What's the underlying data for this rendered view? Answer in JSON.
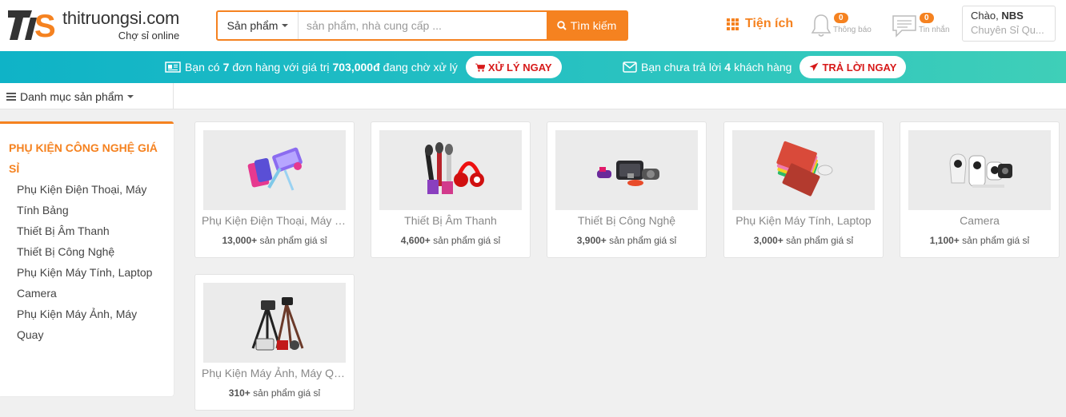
{
  "header": {
    "logo_name": "thitruongsi.com",
    "logo_slogan": "Chợ sỉ online",
    "search": {
      "select_label": "Sản phẩm",
      "placeholder": "sản phẩm, nhà cung cấp ...",
      "value": "",
      "button_label": "Tìm kiếm"
    },
    "tienich_label": "Tiện ích",
    "notifications": {
      "count": "0",
      "label": "Thông báo"
    },
    "messages": {
      "count": "0",
      "label": "Tin nhắn"
    },
    "user": {
      "greeting": "Chào,",
      "name": "NBS",
      "role": "Chuyên Sỉ Qu..."
    }
  },
  "alertbar": {
    "orders": {
      "prefix": "Bạn có",
      "count": "7",
      "middle": "đơn hàng với giá trị",
      "amount": "703,000đ",
      "suffix": "đang chờ xử lý",
      "button_label": "XỬ LÝ NGAY"
    },
    "customers": {
      "prefix": "Bạn chưa trả lời",
      "count": "4",
      "suffix": "khách hàng",
      "button_label": "TRẢ LỜI NGAY"
    }
  },
  "catbar": {
    "toggle_label": "Danh mục sản phẩm"
  },
  "sidebar": {
    "title": "PHỤ KIỆN CÔNG NGHỆ GIÁ SỈ",
    "items": [
      {
        "label": "Phụ Kiện Điện Thoại, Máy Tính Bảng"
      },
      {
        "label": "Thiết Bị Âm Thanh"
      },
      {
        "label": "Thiết Bị Công Nghệ"
      },
      {
        "label": "Phụ Kiện Máy Tính, Laptop"
      },
      {
        "label": "Camera"
      },
      {
        "label": "Phụ Kiện Máy Ảnh, Máy Quay"
      }
    ]
  },
  "cards": [
    {
      "name": "Phụ Kiện Điện Thoại, Máy T...",
      "count": "13,000+",
      "count_suffix": "sản phẩm giá sỉ",
      "image_icon": "phone-accessories-image"
    },
    {
      "name": "Thiết Bị Âm Thanh",
      "count": "4,600+",
      "count_suffix": "sản phẩm giá sỉ",
      "image_icon": "audio-devices-image"
    },
    {
      "name": "Thiết Bị Công Nghệ",
      "count": "3,900+",
      "count_suffix": "sản phẩm giá sỉ",
      "image_icon": "tech-gadgets-image"
    },
    {
      "name": "Phụ Kiện Máy Tính, Laptop",
      "count": "3,000+",
      "count_suffix": "sản phẩm giá sỉ",
      "image_icon": "laptop-accessories-image"
    },
    {
      "name": "Camera",
      "count": "1,100+",
      "count_suffix": "sản phẩm giá sỉ",
      "image_icon": "security-camera-image"
    },
    {
      "name": "Phụ Kiện Máy Ảnh, Máy Quay",
      "count": "310+",
      "count_suffix": "sản phẩm giá sỉ",
      "image_icon": "camera-tripod-image"
    }
  ],
  "colors": {
    "accent": "#f58220",
    "alert_bar_start": "#0fb3c7",
    "alert_bar_end": "#3fcfb8",
    "alert_button_text": "#d71a1a"
  }
}
